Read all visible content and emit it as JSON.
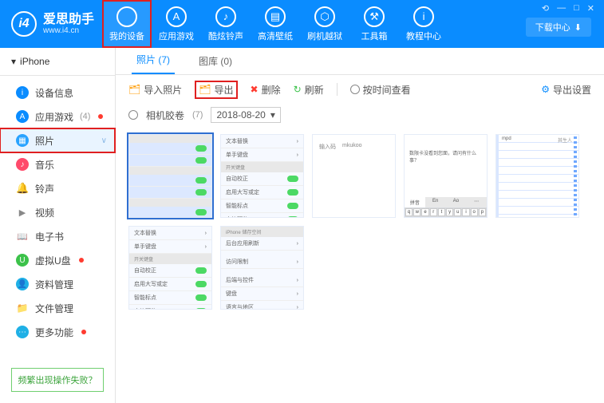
{
  "logo": {
    "name": "爱思助手",
    "url": "www.i4.cn",
    "mark": "i4"
  },
  "win_ctrls": {
    "feedback": "⟲",
    "min": "—",
    "max": "□",
    "close": "✕"
  },
  "download_center": "下载中心",
  "nav": [
    {
      "label": "我的设备",
      "icon": ""
    },
    {
      "label": "应用游戏",
      "icon": "A"
    },
    {
      "label": "酷炫铃声",
      "icon": "♪"
    },
    {
      "label": "高清壁纸",
      "icon": "▤"
    },
    {
      "label": "刷机越狱",
      "icon": "⬡"
    },
    {
      "label": "工具箱",
      "icon": "⚒"
    },
    {
      "label": "教程中心",
      "icon": "i"
    }
  ],
  "device": {
    "name": "iPhone",
    "chev": "▾"
  },
  "sidebar": [
    {
      "label": "设备信息",
      "icon": "i",
      "color": "#0a8cff",
      "dot": false
    },
    {
      "label": "应用游戏",
      "icon": "A",
      "color": "#0a8cff",
      "dot": true,
      "count": "(4)"
    },
    {
      "label": "照片",
      "icon": "▦",
      "color": "#29a3ff",
      "dot": false
    },
    {
      "label": "音乐",
      "icon": "♪",
      "color": "#ff4a6b",
      "dot": false
    },
    {
      "label": "铃声",
      "icon": "🔔",
      "color": "#ffb400",
      "dot": false
    },
    {
      "label": "视频",
      "icon": "▶",
      "color": "#888",
      "dot": false
    },
    {
      "label": "电子书",
      "icon": "📖",
      "color": "#ff8a00",
      "dot": false
    },
    {
      "label": "虚拟U盘",
      "icon": "U",
      "color": "#3cc24a",
      "dot": true
    },
    {
      "label": "资料管理",
      "icon": "👤",
      "color": "#1fb0e6",
      "dot": false
    },
    {
      "label": "文件管理",
      "icon": "📁",
      "color": "#ff8a00",
      "dot": false
    },
    {
      "label": "更多功能",
      "icon": "⋯",
      "color": "#1fb0e6",
      "dot": true
    }
  ],
  "help_link": "频繁出现操作失败？",
  "tabs": {
    "photos": "照片",
    "photos_count": "(7)",
    "library": "图库",
    "library_count": "(0)"
  },
  "toolbar": {
    "import": "导入照片",
    "export": "导出",
    "delete": "删除",
    "refresh": "刷新",
    "view_by_time": "按时间查看",
    "export_settings": "导出设置"
  },
  "filter": {
    "album": "相机胶卷",
    "album_count": "(7)",
    "date": "2018-08-20",
    "caret": "▾"
  },
  "thumb_text": {
    "text_replace": "文本替换",
    "single_keyboard": "单手键盘",
    "kb_section": "开关键盘",
    "auto_correct": "自动校正",
    "caps": "启用大写或定",
    "smart_punct": "智能标点",
    "char_preview": "字符预览",
    "storage": "iPhone 储存空间",
    "bg_refresh": "后台应用刷新",
    "date_time": "访问限制",
    "general": "后端与控件",
    "keyboard": "键盘",
    "lang": "语言与地区",
    "input_prompt": "输入码",
    "brand": "mkukoo",
    "cvv_msg": "数限卡没看到您面，请问有什么事？",
    "kb_pinyin": "拼音",
    "kb_en": "En",
    "kb_ao": "Ao",
    "kb_more": "⋯",
    "keys": [
      "q",
      "w",
      "e",
      "r",
      "t",
      "y",
      "u",
      "i",
      "o",
      "p"
    ],
    "note_title": "mpd",
    "note_author": "其生人"
  }
}
